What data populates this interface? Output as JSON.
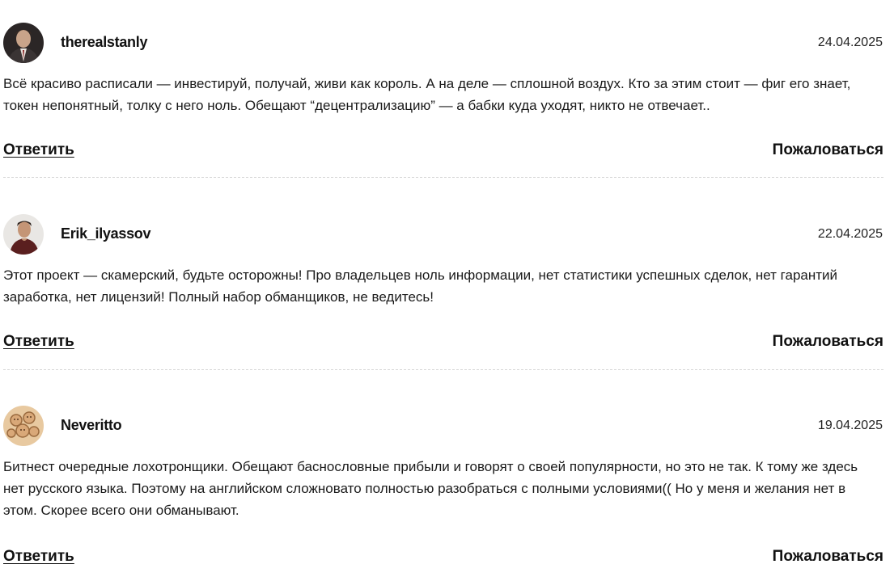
{
  "comments": [
    {
      "author": "therealstanly",
      "date": "24.04.2025",
      "text": "Всё красиво расписали — инвестируй, получай, живи как король. А на деле — сплошной воздух. Кто за этим стоит — фиг его знает, токен непонятный, толку с него ноль. Обещают “децентрализацию” — а бабки куда уходят, никто не отвечает..",
      "reply_label": "Ответить",
      "report_label": "Пожаловаться"
    },
    {
      "author": "Erik_ilyassov",
      "date": "22.04.2025",
      "text": "Этот проект — скамерский, будьте осторожны! Про владельцев ноль информации, нет статистики успешных сделок, нет гарантий заработка, нет лицензий! Полный набор обманщиков, не ведитесь!",
      "reply_label": "Ответить",
      "report_label": "Пожаловаться"
    },
    {
      "author": "Neveritto",
      "date": "19.04.2025",
      "text": "Битнест очередные лохотронщики. Обещают баснословные прибыли и говорят о своей популярности, но это не так. К тому же здесь нет русского языка. Поэтому на английском сложновато полностью разобраться с полными условиями(( Но у меня и желания нет в этом. Скорее всего они обманывают.",
      "reply_label": "Ответить",
      "report_label": "Пожаловаться"
    }
  ]
}
